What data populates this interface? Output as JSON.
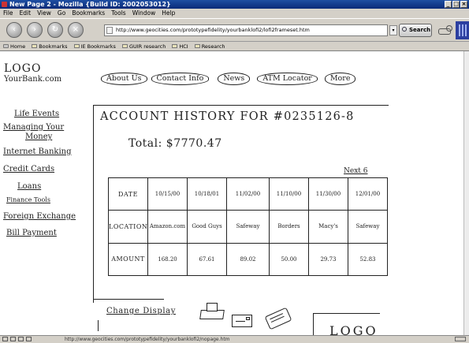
{
  "window": {
    "title": "New Page 2 - Mozilla {Build ID: 2002053012}"
  },
  "menu": [
    "File",
    "Edit",
    "View",
    "Go",
    "Bookmarks",
    "Tools",
    "Window",
    "Help"
  ],
  "nav": {
    "url": "http://www.geocities.com/prototypefidelity/yourbanklofi2/lofi2frameset.htm",
    "search_label": "Search"
  },
  "bookmarks": [
    "Home",
    "Bookmarks",
    "IE Bookmarks",
    "GUIR research",
    "HCI",
    "Research"
  ],
  "site": {
    "logo_line1": "LOGO",
    "logo_line2": "YourBank.com",
    "top_nav": [
      "About Us",
      "Contact Info",
      "News",
      "ATM Locator",
      "More"
    ],
    "sidebar": [
      "Life Events",
      "Managing Your",
      "Money",
      "Internet Banking",
      "Credit Cards",
      "Loans",
      "Finance Tools",
      "Foreign Exchange",
      "Bill Payment"
    ],
    "account_title": "ACCOUNT HISTORY FOR #0235126-8",
    "total": "Total: $7770.47",
    "next_link": "Next 6",
    "table": {
      "row_labels": [
        "DATE",
        "LOCATION",
        "AMOUNT"
      ],
      "dates": [
        "10/15/00",
        "10/18/01",
        "11/02/00",
        "11/10/00",
        "11/30/00",
        "12/01/00"
      ],
      "locations": [
        "Amazon.com",
        "Good Guys",
        "Safeway",
        "Borders",
        "Macy's",
        "Safeway"
      ],
      "amounts": [
        "168.20",
        "67.61",
        "89.02",
        "50.00",
        "29.73",
        "52.83"
      ]
    },
    "change_display": "Change Display",
    "footer_logo": "LOGO"
  },
  "status": {
    "text": "http://www.geocities.com/prototypefidelity/yourbanklofi2/nopage.htm"
  },
  "colors": {
    "titlebar": "#0a2a78",
    "chrome": "#d4d0c8",
    "ink": "#222222"
  },
  "icons": [
    "back-icon",
    "forward-icon",
    "reload-icon",
    "stop-icon",
    "printer-icon",
    "envelope-icon",
    "credit-card-icon"
  ]
}
